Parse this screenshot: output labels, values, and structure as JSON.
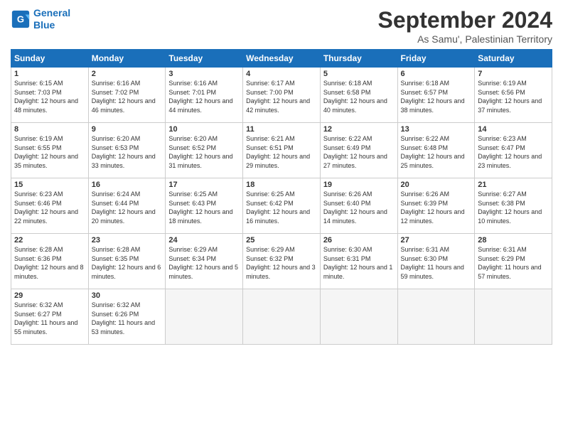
{
  "header": {
    "logo_line1": "General",
    "logo_line2": "Blue",
    "title": "September 2024",
    "subtitle": "As Samu', Palestinian Territory"
  },
  "weekdays": [
    "Sunday",
    "Monday",
    "Tuesday",
    "Wednesday",
    "Thursday",
    "Friday",
    "Saturday"
  ],
  "weeks": [
    [
      {
        "day": "1",
        "sunrise": "6:15 AM",
        "sunset": "7:03 PM",
        "daylight": "12 hours and 48 minutes."
      },
      {
        "day": "2",
        "sunrise": "6:16 AM",
        "sunset": "7:02 PM",
        "daylight": "12 hours and 46 minutes."
      },
      {
        "day": "3",
        "sunrise": "6:16 AM",
        "sunset": "7:01 PM",
        "daylight": "12 hours and 44 minutes."
      },
      {
        "day": "4",
        "sunrise": "6:17 AM",
        "sunset": "7:00 PM",
        "daylight": "12 hours and 42 minutes."
      },
      {
        "day": "5",
        "sunrise": "6:18 AM",
        "sunset": "6:58 PM",
        "daylight": "12 hours and 40 minutes."
      },
      {
        "day": "6",
        "sunrise": "6:18 AM",
        "sunset": "6:57 PM",
        "daylight": "12 hours and 38 minutes."
      },
      {
        "day": "7",
        "sunrise": "6:19 AM",
        "sunset": "6:56 PM",
        "daylight": "12 hours and 37 minutes."
      }
    ],
    [
      {
        "day": "8",
        "sunrise": "6:19 AM",
        "sunset": "6:55 PM",
        "daylight": "12 hours and 35 minutes."
      },
      {
        "day": "9",
        "sunrise": "6:20 AM",
        "sunset": "6:53 PM",
        "daylight": "12 hours and 33 minutes."
      },
      {
        "day": "10",
        "sunrise": "6:20 AM",
        "sunset": "6:52 PM",
        "daylight": "12 hours and 31 minutes."
      },
      {
        "day": "11",
        "sunrise": "6:21 AM",
        "sunset": "6:51 PM",
        "daylight": "12 hours and 29 minutes."
      },
      {
        "day": "12",
        "sunrise": "6:22 AM",
        "sunset": "6:49 PM",
        "daylight": "12 hours and 27 minutes."
      },
      {
        "day": "13",
        "sunrise": "6:22 AM",
        "sunset": "6:48 PM",
        "daylight": "12 hours and 25 minutes."
      },
      {
        "day": "14",
        "sunrise": "6:23 AM",
        "sunset": "6:47 PM",
        "daylight": "12 hours and 23 minutes."
      }
    ],
    [
      {
        "day": "15",
        "sunrise": "6:23 AM",
        "sunset": "6:46 PM",
        "daylight": "12 hours and 22 minutes."
      },
      {
        "day": "16",
        "sunrise": "6:24 AM",
        "sunset": "6:44 PM",
        "daylight": "12 hours and 20 minutes."
      },
      {
        "day": "17",
        "sunrise": "6:25 AM",
        "sunset": "6:43 PM",
        "daylight": "12 hours and 18 minutes."
      },
      {
        "day": "18",
        "sunrise": "6:25 AM",
        "sunset": "6:42 PM",
        "daylight": "12 hours and 16 minutes."
      },
      {
        "day": "19",
        "sunrise": "6:26 AM",
        "sunset": "6:40 PM",
        "daylight": "12 hours and 14 minutes."
      },
      {
        "day": "20",
        "sunrise": "6:26 AM",
        "sunset": "6:39 PM",
        "daylight": "12 hours and 12 minutes."
      },
      {
        "day": "21",
        "sunrise": "6:27 AM",
        "sunset": "6:38 PM",
        "daylight": "12 hours and 10 minutes."
      }
    ],
    [
      {
        "day": "22",
        "sunrise": "6:28 AM",
        "sunset": "6:36 PM",
        "daylight": "12 hours and 8 minutes."
      },
      {
        "day": "23",
        "sunrise": "6:28 AM",
        "sunset": "6:35 PM",
        "daylight": "12 hours and 6 minutes."
      },
      {
        "day": "24",
        "sunrise": "6:29 AM",
        "sunset": "6:34 PM",
        "daylight": "12 hours and 5 minutes."
      },
      {
        "day": "25",
        "sunrise": "6:29 AM",
        "sunset": "6:32 PM",
        "daylight": "12 hours and 3 minutes."
      },
      {
        "day": "26",
        "sunrise": "6:30 AM",
        "sunset": "6:31 PM",
        "daylight": "12 hours and 1 minute."
      },
      {
        "day": "27",
        "sunrise": "6:31 AM",
        "sunset": "6:30 PM",
        "daylight": "11 hours and 59 minutes."
      },
      {
        "day": "28",
        "sunrise": "6:31 AM",
        "sunset": "6:29 PM",
        "daylight": "11 hours and 57 minutes."
      }
    ],
    [
      {
        "day": "29",
        "sunrise": "6:32 AM",
        "sunset": "6:27 PM",
        "daylight": "11 hours and 55 minutes."
      },
      {
        "day": "30",
        "sunrise": "6:32 AM",
        "sunset": "6:26 PM",
        "daylight": "11 hours and 53 minutes."
      },
      null,
      null,
      null,
      null,
      null
    ]
  ]
}
